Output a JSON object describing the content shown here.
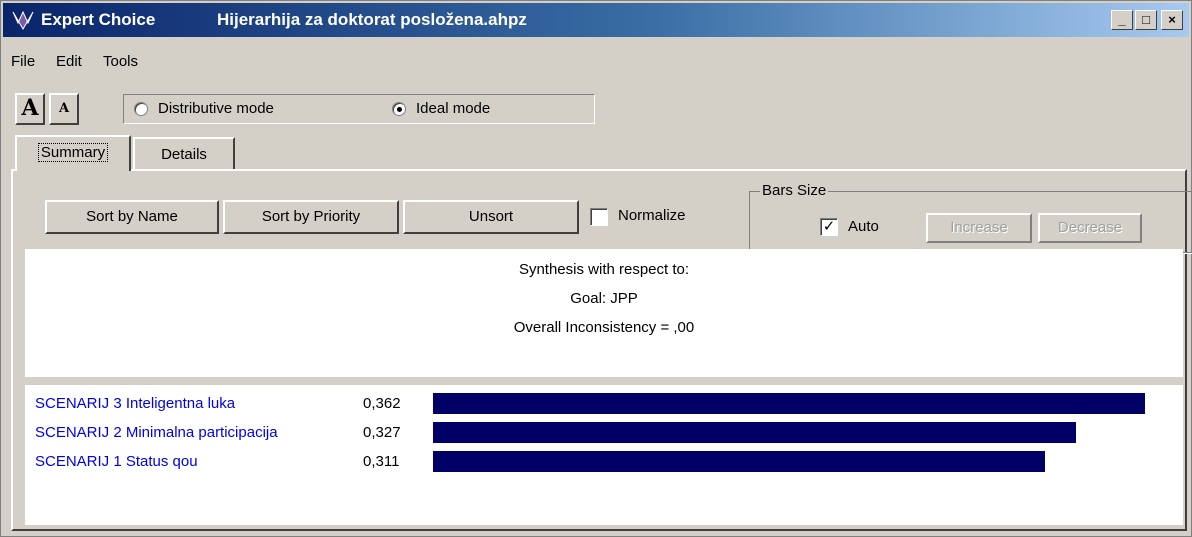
{
  "window": {
    "app_name": "Expert Choice",
    "file_name": "Hijerarhija za doktorat posložena.ahpz",
    "minimize_glyph": "_",
    "maximize_glyph": "□",
    "close_glyph": "×"
  },
  "menu": {
    "file": "File",
    "edit": "Edit",
    "tools": "Tools"
  },
  "font_buttons": {
    "increase": "A",
    "decrease": "A"
  },
  "modes": {
    "distributive": "Distributive mode",
    "ideal": "Ideal mode",
    "selected": "ideal"
  },
  "tabs": {
    "summary": "Summary",
    "details": "Details",
    "active": "summary"
  },
  "toolbar": {
    "sort_by_name": "Sort by Name",
    "sort_by_priority": "Sort by Priority",
    "unsort": "Unsort",
    "normalize": "Normalize",
    "normalize_checked": false
  },
  "bars_size": {
    "legend": "Bars Size",
    "auto": "Auto",
    "auto_checked": true,
    "auto_check_glyph": "✓",
    "increase": "Increase",
    "decrease": "Decrease"
  },
  "synthesis": {
    "line1": "Synthesis with respect to:",
    "line2": "Goal: JPP",
    "line3": "Overall Inconsistency = ,00"
  },
  "alternatives": [
    {
      "name": "SCENARIJ 3 Inteligentna luka",
      "value": "0,362",
      "priority": 0.362
    },
    {
      "name": "SCENARIJ 2 Minimalna participacija",
      "value": "0,327",
      "priority": 0.327
    },
    {
      "name": "SCENARIJ 1 Status qou",
      "value": "0,311",
      "priority": 0.311
    }
  ],
  "colors": {
    "bar": "#000066",
    "alternative_text": "#0000ee",
    "titlebar_start": "#0a246a",
    "titlebar_end": "#a6caf0",
    "app_icon": "#7b5ca8"
  },
  "icons": {
    "app": "expert-choice-logo-icon"
  }
}
